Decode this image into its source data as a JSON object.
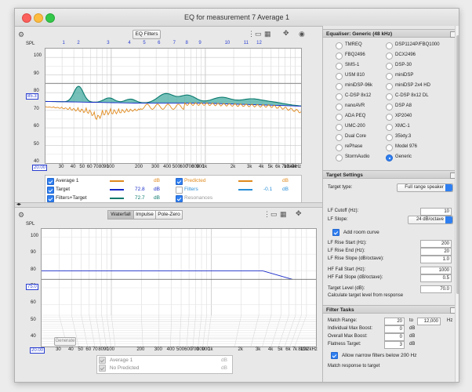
{
  "window": {
    "title": "EQ for measurement 7 Average 1"
  },
  "toolbar": {
    "eq_filters": "EQ Filters",
    "gear": "⚙"
  },
  "top_graph": {
    "y_label": "SPL",
    "y_ticks": [
      "100",
      "90",
      "80",
      "70",
      "60",
      "50",
      "40"
    ],
    "y_marker": "85.3",
    "x_marker": "20.00",
    "x_ticks": [
      "30",
      "40",
      "50",
      "60",
      "70",
      "80",
      "90",
      "100",
      "200",
      "300",
      "400",
      "500",
      "600",
      "700",
      "800",
      "900",
      "1k",
      "2k",
      "3k",
      "4k",
      "5k",
      "6k",
      "7k",
      "8k",
      "9k",
      "10.4kHz"
    ],
    "filter_numbers": [
      "1",
      "2",
      "3",
      "4",
      "5",
      "6",
      "7",
      "8",
      "9",
      "10",
      "11",
      "12"
    ]
  },
  "top_legend": {
    "rows": [
      {
        "label": "Average 1",
        "value": "",
        "unit": "dB",
        "color": "#e08a1e",
        "checked": true
      },
      {
        "label": "Target",
        "value": "72.8",
        "unit": "dB",
        "color": "#1a2cc8",
        "checked": true
      },
      {
        "label": "Filters+Target",
        "value": "72.7",
        "unit": "dB",
        "color": "#0b7a6e",
        "checked": true
      }
    ],
    "rows_right": [
      {
        "label": "Predicted",
        "value": "",
        "unit": "dB",
        "color": "#e08a1e",
        "checked": true
      },
      {
        "label": "Filters",
        "value": "-0.1",
        "unit": "dB",
        "color": "#2a8fd8",
        "checked": false
      },
      {
        "label": "Resonances",
        "value": "",
        "unit": "",
        "color": "#999999",
        "checked": true
      }
    ]
  },
  "bottom_tabs": [
    "Waterfall",
    "Impulse",
    "Pole-Zero"
  ],
  "bottom_graph": {
    "y_label": "SPL",
    "y_ticks": [
      "100",
      "90",
      "80",
      "70",
      "60",
      "50",
      "40"
    ],
    "y_marker": "75.0",
    "x_marker": "20.00",
    "x_ticks": [
      "30",
      "40",
      "50",
      "60",
      "70",
      "80",
      "90",
      "100",
      "200",
      "300",
      "400",
      "500",
      "600",
      "700",
      "800",
      "900",
      "1k",
      "2k",
      "3k",
      "4k",
      "5k",
      "6k",
      "7k",
      "8k",
      "9k",
      "11.2kHz"
    ],
    "generate": "Generate"
  },
  "bottom_legend": {
    "rows": [
      {
        "label": "Average 1",
        "unit": "dB"
      },
      {
        "label": "No Predicted",
        "unit": "dB"
      }
    ]
  },
  "equaliser": {
    "header": "Equaliser: Generic (48 kHz)",
    "options": [
      [
        "TMREQ",
        "DSP1124P/FBQ1000"
      ],
      [
        "FBQ2496",
        "DCX2496"
      ],
      [
        "SMS-1",
        "DSP-30"
      ],
      [
        "USM 810",
        "miniDSP"
      ],
      [
        "miniDSP-96k",
        "miniDSP 2x4 HD"
      ],
      [
        "C-DSP 8x12",
        "C-DSP 8x12 DL"
      ],
      [
        "nanoAVR",
        "DSP A8"
      ],
      [
        "ADA PEQ",
        "XP2040"
      ],
      [
        "UMC-200",
        "XMC-1"
      ],
      [
        "Dual Core",
        "35ixty.3"
      ],
      [
        "rePhase",
        "Model 976"
      ],
      [
        "StormAudio",
        "Generic"
      ]
    ],
    "selected": "Generic"
  },
  "target_settings": {
    "header": "Target Settings",
    "target_type_label": "Target type:",
    "target_type": "Full range speaker",
    "lf_cutoff_label": "LF Cutoff (Hz):",
    "lf_cutoff": "10",
    "lf_slope_label": "LF Slope:",
    "lf_slope": "24 dB/octave",
    "add_room_curve": "Add room curve",
    "lf_rise_start_label": "LF Rise Start (Hz):",
    "lf_rise_start": "200",
    "lf_rise_end_label": "LF Rise End (Hz):",
    "lf_rise_end": "20",
    "lf_rise_slope_label": "LF Rise Slope (dB/octave):",
    "lf_rise_slope": "1.0",
    "hf_fall_start_label": "HF Fall Start (Hz):",
    "hf_fall_start": "1000",
    "hf_fall_slope_label": "HF Fall Slope (dB/octave):",
    "hf_fall_slope": "0.5",
    "target_level_label": "Target Level (dB):",
    "target_level": "70.0",
    "calc_label": "Calculate target level from response"
  },
  "filter_tasks": {
    "header": "Filter Tasks",
    "match_range_label": "Match Range:",
    "match_from": "20",
    "to_label": "to",
    "match_to": "12,000",
    "hz": "Hz",
    "indiv_max_boost_label": "Individual Max Boost:",
    "indiv_max_boost": "0",
    "overall_max_boost_label": "Overall Max Boost:",
    "overall_max_boost": "0",
    "flatness_label": "Flatness Target:",
    "flatness": "3",
    "db": "dB",
    "narrow_label": "Allow narrow filters below 200 Hz",
    "match_response": "Match response to target"
  },
  "colors": {
    "measurement": "#e08a1e",
    "target": "#1a2cc8",
    "filters_target": "#0b7a6e",
    "fill": "#3aa79c"
  }
}
